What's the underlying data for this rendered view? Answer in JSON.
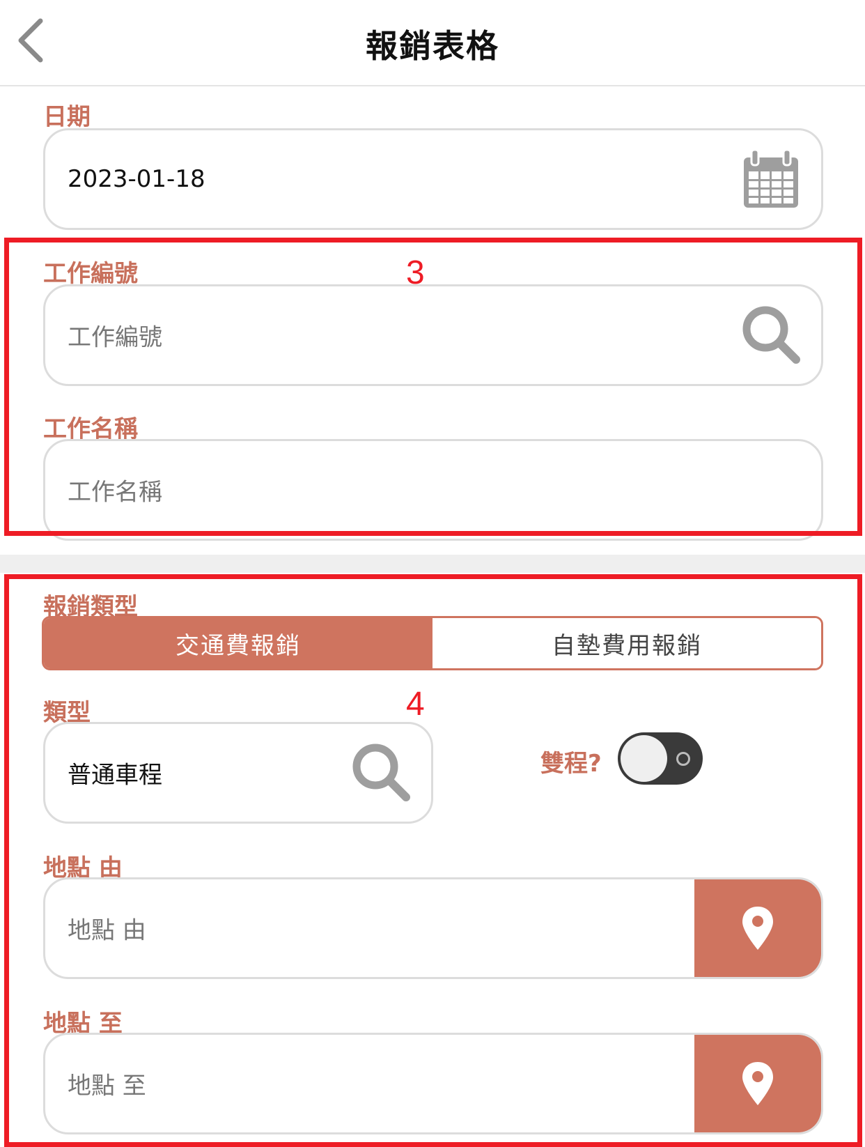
{
  "header": {
    "title": "報銷表格",
    "back_icon": "chevron-left-icon"
  },
  "date": {
    "label": "日期",
    "value": "2023-01-18",
    "icon": "calendar-icon"
  },
  "job_number": {
    "label": "工作編號",
    "placeholder": "工作編號",
    "icon": "search-icon"
  },
  "job_name": {
    "label": "工作名稱",
    "placeholder": "工作名稱"
  },
  "expense_type": {
    "label": "報銷類型",
    "options": [
      "交通費報銷",
      "自墊費用報銷"
    ],
    "selected": "交通費報銷"
  },
  "category": {
    "label": "類型",
    "value": "普通車程",
    "icon": "search-icon"
  },
  "round_trip": {
    "label": "雙程?",
    "on": false
  },
  "location_from": {
    "label": "地點 由",
    "placeholder": "地點 由",
    "icon": "map-pin-icon"
  },
  "location_to": {
    "label": "地點 至",
    "placeholder": "地點 至",
    "icon": "map-pin-icon"
  },
  "annotations": [
    "3",
    "4"
  ],
  "colors": {
    "accent": "#cf745f",
    "label": "#c8705c",
    "annotation": "#ee1c25",
    "toggle_track": "#3a3a3a"
  }
}
